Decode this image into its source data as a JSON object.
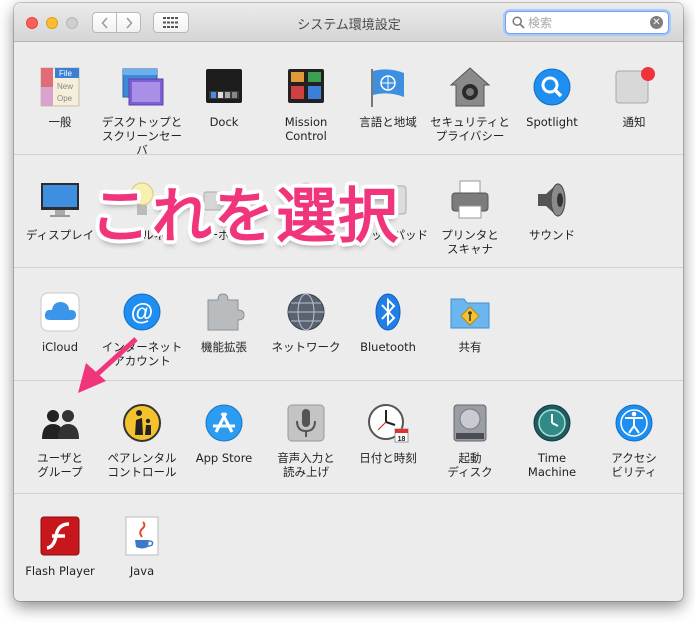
{
  "window": {
    "title": "システム環境設定",
    "search": {
      "placeholder": "検索",
      "value": ""
    }
  },
  "sections": [
    {
      "items": [
        {
          "id": "general",
          "label": "一般",
          "icon": "general-icon"
        },
        {
          "id": "desktop",
          "label": "デスクトップと\nスクリーンセーバ",
          "icon": "desktop-icon"
        },
        {
          "id": "dock",
          "label": "Dock",
          "icon": "dock-icon"
        },
        {
          "id": "mission-control",
          "label": "Mission\nControl",
          "icon": "mission-control-icon"
        },
        {
          "id": "language",
          "label": "言語と地域",
          "icon": "flag-icon"
        },
        {
          "id": "security",
          "label": "セキュリティと\nプライバシー",
          "icon": "house-lock-icon"
        },
        {
          "id": "spotlight",
          "label": "Spotlight",
          "icon": "magnifier-icon"
        },
        {
          "id": "notifications",
          "label": "通知",
          "icon": "notification-icon"
        }
      ]
    },
    {
      "items": [
        {
          "id": "display",
          "label": "ディスプレイ",
          "icon": "monitor-icon"
        },
        {
          "id": "energy",
          "label": "省エネルギー",
          "icon": "lightbulb-icon"
        },
        {
          "id": "keyboard",
          "label": "キーボード",
          "icon": "keyboard-icon"
        },
        {
          "id": "mouse",
          "label": "マウス",
          "icon": "mouse-icon"
        },
        {
          "id": "trackpad",
          "label": "トラックパッド",
          "icon": "trackpad-icon"
        },
        {
          "id": "printers",
          "label": "プリンタと\nスキャナ",
          "icon": "printer-icon"
        },
        {
          "id": "sound",
          "label": "サウンド",
          "icon": "speaker-icon"
        }
      ]
    },
    {
      "items": [
        {
          "id": "icloud",
          "label": "iCloud",
          "icon": "cloud-icon"
        },
        {
          "id": "internet-accounts",
          "label": "インターネット\nアカウント",
          "icon": "at-sign-icon"
        },
        {
          "id": "extensions",
          "label": "機能拡張",
          "icon": "puzzle-icon"
        },
        {
          "id": "network",
          "label": "ネットワーク",
          "icon": "globe-icon"
        },
        {
          "id": "bluetooth",
          "label": "Bluetooth",
          "icon": "bluetooth-icon"
        },
        {
          "id": "sharing",
          "label": "共有",
          "icon": "shared-folder-icon"
        }
      ]
    },
    {
      "items": [
        {
          "id": "users",
          "label": "ユーザと\nグループ",
          "icon": "users-icon"
        },
        {
          "id": "parental",
          "label": "ペアレンタル\nコントロール",
          "icon": "parental-icon"
        },
        {
          "id": "appstore",
          "label": "App Store",
          "icon": "app-store-icon"
        },
        {
          "id": "dictation",
          "label": "音声入力と\n読み上げ",
          "icon": "microphone-icon"
        },
        {
          "id": "datetime",
          "label": "日付と時刻",
          "icon": "clock-icon"
        },
        {
          "id": "startup",
          "label": "起動\nディスク",
          "icon": "hard-disk-icon"
        },
        {
          "id": "timemachine",
          "label": "Time\nMachine",
          "icon": "time-machine-icon"
        },
        {
          "id": "accessibility",
          "label": "アクセシ\nビリティ",
          "icon": "accessibility-icon"
        }
      ]
    },
    {
      "items": [
        {
          "id": "flash",
          "label": "Flash Player",
          "icon": "flash-icon"
        },
        {
          "id": "java",
          "label": "Java",
          "icon": "java-icon"
        }
      ]
    }
  ],
  "overlay": {
    "text": "これを選択",
    "color": "#f0357d"
  }
}
